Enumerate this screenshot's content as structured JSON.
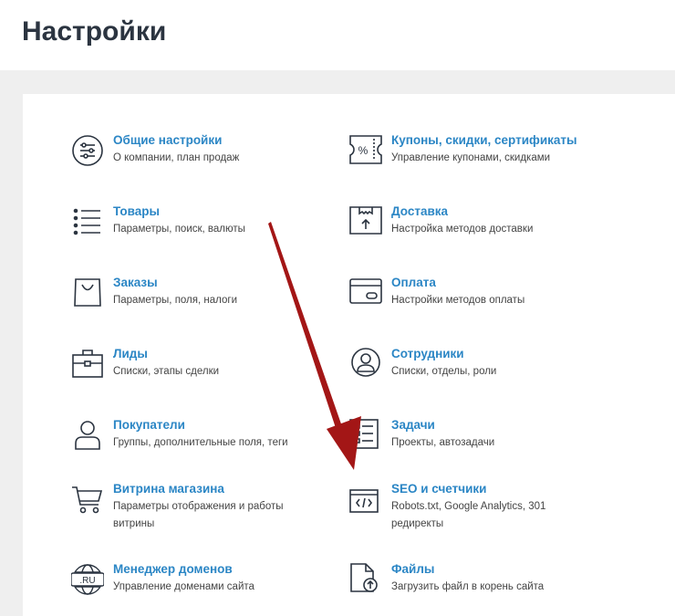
{
  "page": {
    "title": "Настройки"
  },
  "settings": {
    "left": [
      {
        "title": "Общие настройки",
        "desc": "О компании, план продаж",
        "icon": "sliders-icon"
      },
      {
        "title": "Товары",
        "desc": "Параметры, поиск, валюты",
        "icon": "list-icon"
      },
      {
        "title": "Заказы",
        "desc": "Параметры, поля, налоги",
        "icon": "shopping-bag-icon"
      },
      {
        "title": "Лиды",
        "desc": "Списки, этапы сделки",
        "icon": "briefcase-icon"
      },
      {
        "title": "Покупатели",
        "desc": "Группы, дополнительные поля, теги",
        "icon": "user-icon"
      },
      {
        "title": "Витрина магазина",
        "desc": "Параметры отображения и работы витрины",
        "icon": "cart-icon"
      },
      {
        "title": "Менеджер доменов",
        "desc": "Управление доменами сайта",
        "icon": "globe-ru-icon",
        "icon_text": ".RU"
      }
    ],
    "right": [
      {
        "title": "Купоны, скидки, сертификаты",
        "desc": "Управление купонами, скидками",
        "icon": "coupon-icon",
        "icon_text": "%"
      },
      {
        "title": "Доставка",
        "desc": "Настройка методов доставки",
        "icon": "delivery-box-icon"
      },
      {
        "title": "Оплата",
        "desc": "Настройки методов оплаты",
        "icon": "credit-card-icon"
      },
      {
        "title": "Сотрудники",
        "desc": "Списки, отделы, роли",
        "icon": "employee-icon"
      },
      {
        "title": "Задачи",
        "desc": "Проекты, автозадачи",
        "icon": "checklist-icon"
      },
      {
        "title": "SEO и счетчики",
        "desc": "Robots.txt, Google Analytics, 301 редиректы",
        "icon": "code-window-icon"
      },
      {
        "title": "Файлы",
        "desc": "Загрузить файл в корень сайта",
        "icon": "file-upload-icon"
      }
    ]
  },
  "colors": {
    "link": "#2b86c5",
    "icon": "#2b3440",
    "arrow": "#a31616",
    "panel_bg": "#efefef"
  }
}
